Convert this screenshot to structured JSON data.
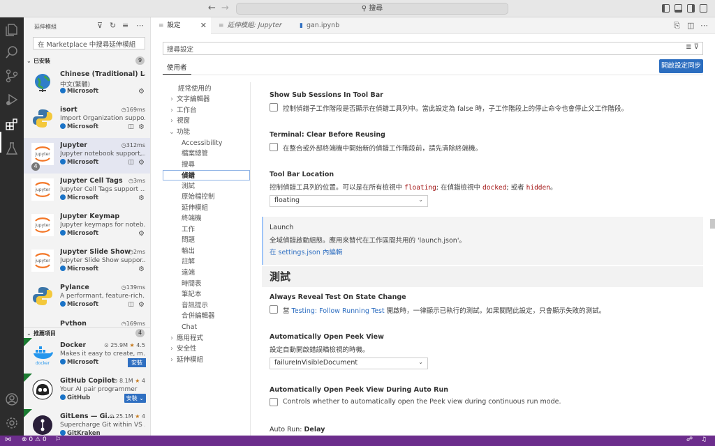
{
  "command_center": {
    "text": "搜尋"
  },
  "sidebar": {
    "title": "延伸模組",
    "search_placeholder": "在 Marketplace 中搜尋延伸模組",
    "installed": {
      "label": "已安裝",
      "count": "9"
    },
    "recommended": {
      "label": "推薦項目",
      "count": "4"
    },
    "installed_items": [
      {
        "name": "Chinese (Traditional) La...",
        "desc": "中文(繁體)",
        "publisher": "Microsoft",
        "stat": ""
      },
      {
        "name": "isort",
        "desc": "Import Organization suppo...",
        "publisher": "Microsoft",
        "stat": "169ms"
      },
      {
        "name": "Jupyter",
        "desc": "Jupyter notebook support,...",
        "publisher": "Microsoft",
        "stat": "312ms",
        "badge": "4"
      },
      {
        "name": "Jupyter Cell Tags",
        "desc": "Jupyter Cell Tags support ...",
        "publisher": "Microsoft",
        "stat": "3ms"
      },
      {
        "name": "Jupyter Keymap",
        "desc": "Jupyter keymaps for noteb...",
        "publisher": "Microsoft",
        "stat": ""
      },
      {
        "name": "Jupyter Slide Show",
        "desc": "Jupyter Slide Show suppor...",
        "publisher": "Microsoft",
        "stat": "2ms"
      },
      {
        "name": "Pylance",
        "desc": "A performant, feature-rich...",
        "publisher": "Microsoft",
        "stat": "139ms"
      },
      {
        "name": "Python",
        "stat": "169ms"
      }
    ],
    "recommended_items": [
      {
        "name": "Docker",
        "desc": "Makes it easy to create, m...",
        "publisher": "Microsoft",
        "downloads": "25.9M",
        "rating": "4.5",
        "install": "安裝"
      },
      {
        "name": "GitHub Copilot",
        "desc": "Your AI pair programmer",
        "publisher": "GitHub",
        "downloads": "8.1M",
        "rating": "4",
        "install": "安裝"
      },
      {
        "name": "GitLens — Gi...",
        "desc": "Supercharge Git within VS ...",
        "publisher": "GitKraken",
        "downloads": "25.1M",
        "rating": "4"
      }
    ]
  },
  "tabs": [
    {
      "label": "設定",
      "active": true
    },
    {
      "label": "延伸模組: Jupyter",
      "active": false
    },
    {
      "label": "gan.ipynb",
      "active": false
    }
  ],
  "settings": {
    "search_placeholder": "搜尋設定",
    "scope_tab": "使用者",
    "sync_button": "開啟設定同步",
    "toc": [
      "經常使用的",
      "文字編輯器",
      "工作台",
      "視窗",
      "功能",
      "Accessibility",
      "檔案總管",
      "搜尋",
      "偵錯",
      "測試",
      "原始檔控制",
      "延伸模組",
      "終端機",
      "工作",
      "問題",
      "輸出",
      "註解",
      "遠端",
      "時間表",
      "筆記本",
      "音訊提示",
      "合併編輯器",
      "Chat",
      "應用程式",
      "安全性",
      "延伸模組"
    ],
    "items": {
      "sub_sessions": {
        "title": "Show Sub Sessions In Tool Bar",
        "desc": "控制偵錯子工作階段是否顯示在偵錯工具列中。當此設定為 false 時，子工作階段上的停止命令也會停止父工作階段。"
      },
      "clear_before": {
        "category": "Terminal: ",
        "title": "Clear Before Reusing",
        "desc": "在整合或外部終端機中開始新的偵錯工作階段前，請先清除終端機。"
      },
      "toolbar_loc": {
        "title": "Tool Bar Location",
        "desc_a": "控制偵錯工具列的位置。可以是在所有檢視中 ",
        "code1": "floating",
        "desc_b": "; 在偵錯檢視中 ",
        "code2": "docked",
        "desc_c": "; 或者 ",
        "code3": "hidden",
        "desc_d": "。",
        "value": "floating"
      },
      "launch": {
        "title": "Launch",
        "desc": "全域偵錯啟動組態。應用來替代在工作區間共用的 'launch.json'。",
        "link": "在 settings.json 內編輯"
      },
      "test_header": "測試",
      "reveal_test": {
        "title": "Always Reveal Test On State Change",
        "desc_a": "當 ",
        "link": "Testing: Follow Running Test",
        "desc_b": " 開啟時，一律顯示已執行的測試。如果關閉此設定，只會顯示失敗的測試。"
      },
      "open_peek": {
        "title": "Automatically Open Peek View",
        "desc": "設定自動開啟錯誤瞄檢視的時機。",
        "value": "failureInVisibleDocument"
      },
      "open_peek_auto": {
        "title": "Automatically Open Peek View During Auto Run",
        "desc": "Controls whether to automatically open the Peek view during continuous run mode."
      },
      "auto_run": {
        "category": "Auto Run: ",
        "title": "Delay"
      }
    }
  },
  "status": {
    "errors": "0",
    "warnings": "0"
  }
}
